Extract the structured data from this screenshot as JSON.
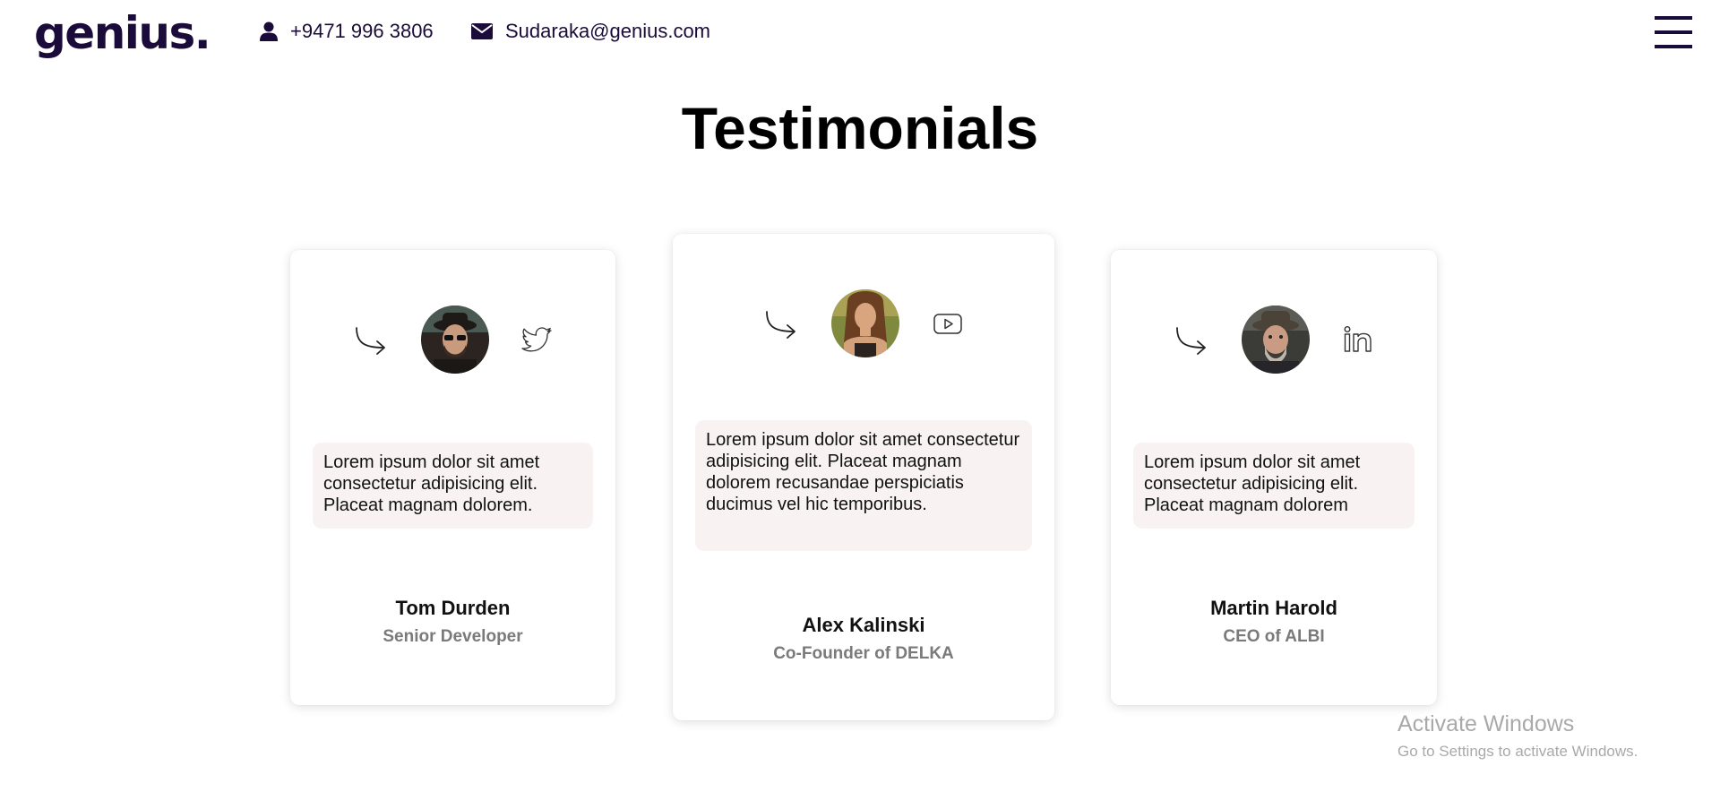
{
  "header": {
    "logo": "genius.",
    "phone": "+9471 996 3806",
    "email": "Sudaraka@genius.com",
    "icons": {
      "phone": "user-icon",
      "email": "envelope-icon",
      "menu": "hamburger-menu-icon"
    }
  },
  "title": "Testimonials",
  "testimonials": [
    {
      "quote": "Lorem ipsum dolor sit amet consectetur adipisicing elit. Placeat magnam dolorem.",
      "name": "Tom Durden",
      "role": "Senior Developer",
      "social_icon": "twitter-icon"
    },
    {
      "quote": "Lorem ipsum dolor sit amet consectetur adipisicing elit. Placeat magnam dolorem recusandae perspiciatis ducimus vel hic temporibus.",
      "name": "Alex Kalinski",
      "role": "Co-Founder of DELKA",
      "social_icon": "youtube-icon"
    },
    {
      "quote": "Lorem ipsum dolor sit amet consectetur adipisicing elit. Placeat magnam dolorem",
      "name": "Martin Harold",
      "role": "CEO of ALBI",
      "social_icon": "linkedin-icon"
    }
  ],
  "watermark": {
    "title": "Activate Windows",
    "subtitle": "Go to Settings to activate Windows."
  },
  "colors": {
    "brand": "#1a0b3b",
    "quote_bg": "#f8f3f2",
    "role_text": "#7a7a7a"
  }
}
